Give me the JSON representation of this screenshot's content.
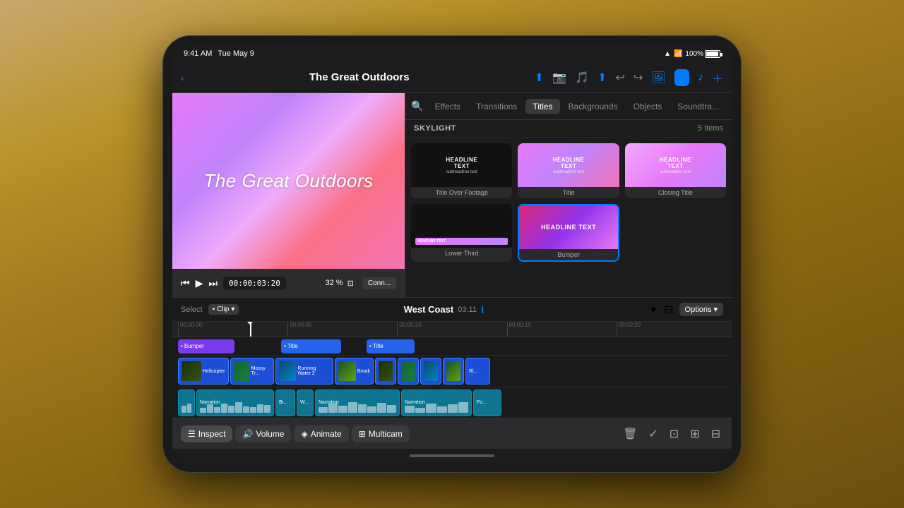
{
  "device": {
    "status_bar": {
      "time": "9:41 AM",
      "date": "Tue May 9",
      "wifi": "100%",
      "battery": "100%"
    }
  },
  "nav": {
    "back_label": "‹",
    "title": "The Great Outdoors",
    "icons": [
      "upload",
      "camera",
      "location",
      "share"
    ]
  },
  "video_preview": {
    "title": "The Great Outdoors"
  },
  "playback": {
    "time": "00:00:03:20",
    "zoom": "32 %",
    "connect": "Conn..."
  },
  "browser": {
    "tabs": [
      {
        "label": "Effects",
        "active": false
      },
      {
        "label": "Transitions",
        "active": false
      },
      {
        "label": "Titles",
        "active": true
      },
      {
        "label": "Backgrounds",
        "active": false
      },
      {
        "label": "Objects",
        "active": false
      },
      {
        "label": "Soundtra...",
        "active": false
      }
    ],
    "section": {
      "label": "SKYLIGHT",
      "count": "5 Items"
    },
    "title_cards": [
      {
        "label": "Title Over Footage",
        "type": "dark"
      },
      {
        "label": "Title",
        "type": "pink"
      },
      {
        "label": "Closing Title",
        "type": "pinklight"
      },
      {
        "label": "Lower Third",
        "type": "dark_lower"
      },
      {
        "label": "Bumper",
        "type": "pink_selected"
      }
    ]
  },
  "timeline": {
    "select_label": "Select",
    "clip_label": "Clip",
    "project_name": "West Coast",
    "duration": "03:11",
    "options_label": "Options",
    "ruler_marks": [
      "00:00:00",
      "00:00:05",
      "00:00:10",
      "00:00:15",
      "00:00:20"
    ],
    "title_clips": [
      {
        "label": "Bumper",
        "color": "purple",
        "width": 80
      },
      {
        "label": "Title",
        "color": "blue",
        "width": 85
      },
      {
        "label": "Title",
        "color": "blue",
        "width": 68
      }
    ],
    "video_clips": [
      {
        "label": "Helicopter",
        "thumb": "heli"
      },
      {
        "label": "Mossy Tr...",
        "thumb": "green"
      },
      {
        "label": "Running Water 2",
        "thumb": "water"
      },
      {
        "label": "Brook",
        "thumb": "brook"
      },
      {
        "label": "",
        "thumb": "forest"
      },
      {
        "label": "",
        "thumb": "forest"
      },
      {
        "label": "",
        "thumb": "forest"
      },
      {
        "label": "Ri...",
        "thumb": "forest"
      }
    ],
    "audio_clips": [
      {
        "label": "Narration",
        "color": "teal"
      },
      {
        "label": "Bi...",
        "color": "teal"
      },
      {
        "label": "W...",
        "color": "teal"
      },
      {
        "label": "Narration",
        "color": "teal"
      },
      {
        "label": "Narration",
        "color": "teal"
      },
      {
        "label": "Fo...",
        "color": "teal"
      }
    ]
  },
  "toolbar": {
    "inspect_label": "Inspect",
    "volume_label": "Volume",
    "animate_label": "Animate",
    "multicam_label": "Multicam"
  }
}
